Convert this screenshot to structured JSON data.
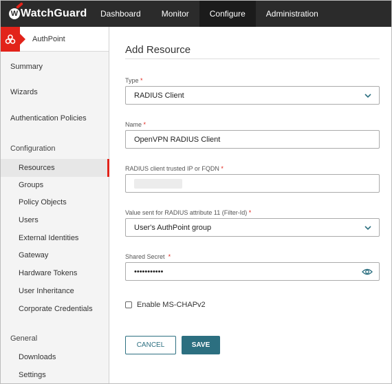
{
  "brand": {
    "name": "WatchGuard",
    "logo_letter": "W",
    "accent": "#e2231a",
    "primary": "#2c6f80"
  },
  "nav": {
    "items": [
      {
        "label": "Dashboard"
      },
      {
        "label": "Monitor"
      },
      {
        "label": "Configure",
        "active": true
      },
      {
        "label": "Administration"
      }
    ]
  },
  "sidebar": {
    "product": "AuthPoint",
    "product_icon": "authpoint-icon",
    "items": [
      {
        "label": "Summary"
      },
      {
        "label": "Wizards"
      },
      {
        "label": "Authentication Policies"
      },
      {
        "label": "Configuration"
      },
      {
        "label": "Resources",
        "active": true
      },
      {
        "label": "Groups"
      },
      {
        "label": "Policy Objects"
      },
      {
        "label": "Users"
      },
      {
        "label": "External Identities"
      },
      {
        "label": "Gateway"
      },
      {
        "label": "Hardware Tokens"
      },
      {
        "label": "User Inheritance"
      },
      {
        "label": "Corporate Credentials"
      },
      {
        "label": "General"
      },
      {
        "label": "Downloads"
      },
      {
        "label": "Settings"
      }
    ]
  },
  "form": {
    "title": "Add Resource",
    "required_mark": "*",
    "type": {
      "label": "Type",
      "value": "RADIUS Client"
    },
    "name": {
      "label": "Name",
      "value": "OpenVPN RADIUS Client"
    },
    "trusted_ip": {
      "label": "RADIUS client trusted IP or FQDN",
      "value": ""
    },
    "filter_id": {
      "label": "Value sent for RADIUS attribute 11 (Filter-Id)",
      "value": "User's AuthPoint group"
    },
    "shared_secret": {
      "label": "Shared Secret",
      "value": "•••••••••••"
    },
    "mschap": {
      "label": "Enable MS-CHAPv2",
      "checked": false
    },
    "cancel_label": "CANCEL",
    "save_label": "SAVE"
  }
}
